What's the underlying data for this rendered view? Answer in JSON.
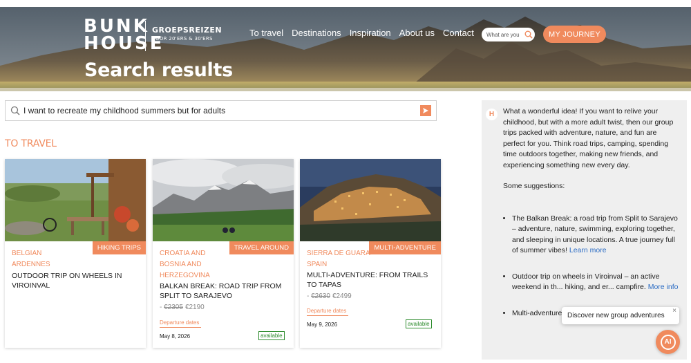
{
  "header": {
    "logo": {
      "line1": "BUNK",
      "line2": "HOUSE",
      "sub1": "GROEPSREIZEN",
      "sub2": "VOOR 20'ERS & 30'ERS"
    },
    "nav": [
      "To travel",
      "Destinations",
      "Inspiration",
      "About us",
      "Contact"
    ],
    "search_placeholder": "What are you",
    "cta_label": "MY JOURNEY",
    "page_title": "Search results"
  },
  "search": {
    "query": "I want to recreate my childhood summers but for adults"
  },
  "section_title": "TO TRAVEL",
  "cards": [
    {
      "tag": "HIKING TRIPS",
      "location": "BELGIAN ARDENNES",
      "title": "OUTDOOR TRIP ON WHEELS IN VIROINVAL"
    },
    {
      "tag": "TRAVEL AROUND",
      "location": "CROATIA AND BOSNIA AND HERZEGOVINA",
      "title": "BALKAN BREAK: ROAD TRIP FROM SPLIT TO SARAJEVO",
      "price_prefix": "-",
      "old_price": "€2305",
      "new_price": "€2190",
      "departure_label": "Departure dates",
      "date": "May 8, 2026",
      "availability": "available"
    },
    {
      "tag": "MULTI-ADVENTURE",
      "location": "SIERRA DE GUARA SPAIN",
      "title": "MULTI-ADVENTURE: FROM TRAILS TO TAPAS",
      "price_prefix": "-",
      "old_price": "€2630",
      "new_price": "€2499",
      "departure_label": "Departure dates",
      "date": "May 9, 2026",
      "availability": "available"
    }
  ],
  "ai": {
    "avatar_letter": "H",
    "intro": "What a wonderful idea! If you want to relive your childhood, but with a more adult twist, then our group trips packed with adventure, nature, and fun are perfect for you. Think road trips, camping, spending time outdoors together, making new friends, and experiencing something new every day.",
    "suggestions_label": "Some suggestions:",
    "items": [
      {
        "text": "The Balkan Break: a road trip from Split to Sarajevo – adventure, nature, swimming, exploring together, and sleeping in unique locations. A true journey full of summer vibes!",
        "link": "Learn more"
      },
      {
        "text": "Outdoor trip on wheels in Viroinval – an active weekend in th... hiking, and er... campfire.",
        "link": "More info"
      },
      {
        "text": "Multi-adventure: From trails to tapas in Spain",
        "link": ""
      }
    ],
    "popup_text": "Discover new group adventures",
    "popup_close": "×",
    "fab_label": "AI"
  },
  "colors": {
    "accent": "#f08a5d",
    "link": "#2b6cc4",
    "available": "#2a8a2a"
  }
}
